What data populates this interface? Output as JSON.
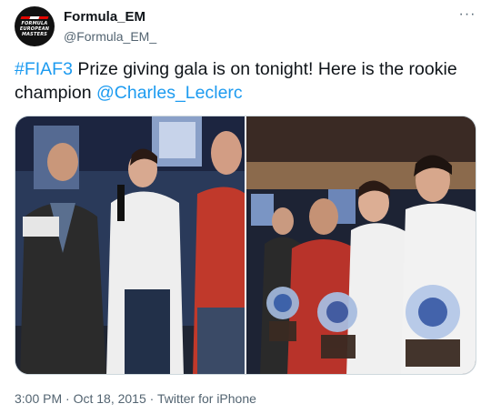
{
  "user": {
    "display_name": "Formula_EM",
    "handle": "@Formula_EM_",
    "avatar_logo_lines": [
      "FORMULA",
      "EUROPEAN",
      "MASTERS"
    ]
  },
  "menu_icon": "more-horizontal-icon",
  "menu_glyph": "···",
  "tweet": {
    "hashtag": "#FIAF3",
    "text_part1": " Prize giving gala is on tonight! Here is the rookie champion ",
    "mention": "@Charles_Leclerc"
  },
  "footer": {
    "time": "3:00 PM",
    "separator": " · ",
    "date": "Oct 18, 2015",
    "source": "Twitter for iPhone"
  },
  "colors": {
    "text": "#0f1419",
    "secondary": "#536471",
    "link": "#1d9bf0",
    "border": "#cfd9de"
  }
}
